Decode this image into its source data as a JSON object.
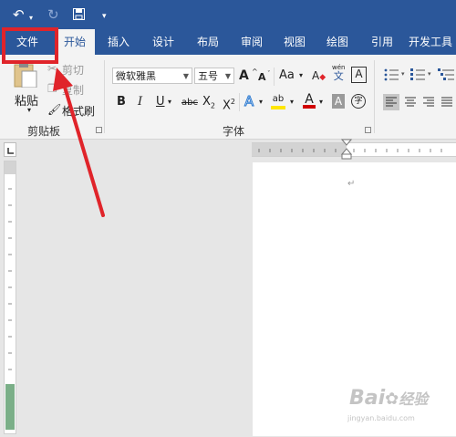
{
  "qat": {
    "undo_icon": "undo-icon",
    "redo_icon": "redo-icon",
    "save_icon": "save-icon",
    "customize_icon": "qat-customize-icon"
  },
  "tabs": [
    "文件",
    "开始",
    "插入",
    "设计",
    "布局",
    "审阅",
    "视图",
    "绘图",
    "引用",
    "开发工具"
  ],
  "active_tab": "开始",
  "clipboard": {
    "paste": "粘贴",
    "cut": "剪切",
    "copy": "复制",
    "format_painter": "格式刷",
    "group_label": "剪贴板"
  },
  "font": {
    "font_name": "微软雅黑",
    "font_size": "五号",
    "grow": "A",
    "shrink": "A",
    "change_case": "Aa",
    "clear_format": "A",
    "phonetic_top": "wén",
    "phonetic_bottom": "文",
    "char_border": "A",
    "bold": "B",
    "italic": "I",
    "underline": "U",
    "strikethrough": "abc",
    "subscript": "X",
    "subscript_mark": "2",
    "superscript": "X",
    "superscript_mark": "2",
    "text_effect": "A",
    "highlight": "ab",
    "font_color": "A",
    "char_shading": "A",
    "enclose_char": "字",
    "group_label": "字体"
  },
  "paragraph_mark": "↵",
  "watermark": {
    "brand": "Bai",
    "brand2": "经验",
    "url": "jingyan.baidu.com"
  },
  "colors": {
    "title_bar": "#2b579a",
    "ribbon": "#f3f3f3",
    "annotation_red": "#e0242a",
    "highlight_yellow": "#ffe600",
    "font_red": "#d00000"
  }
}
